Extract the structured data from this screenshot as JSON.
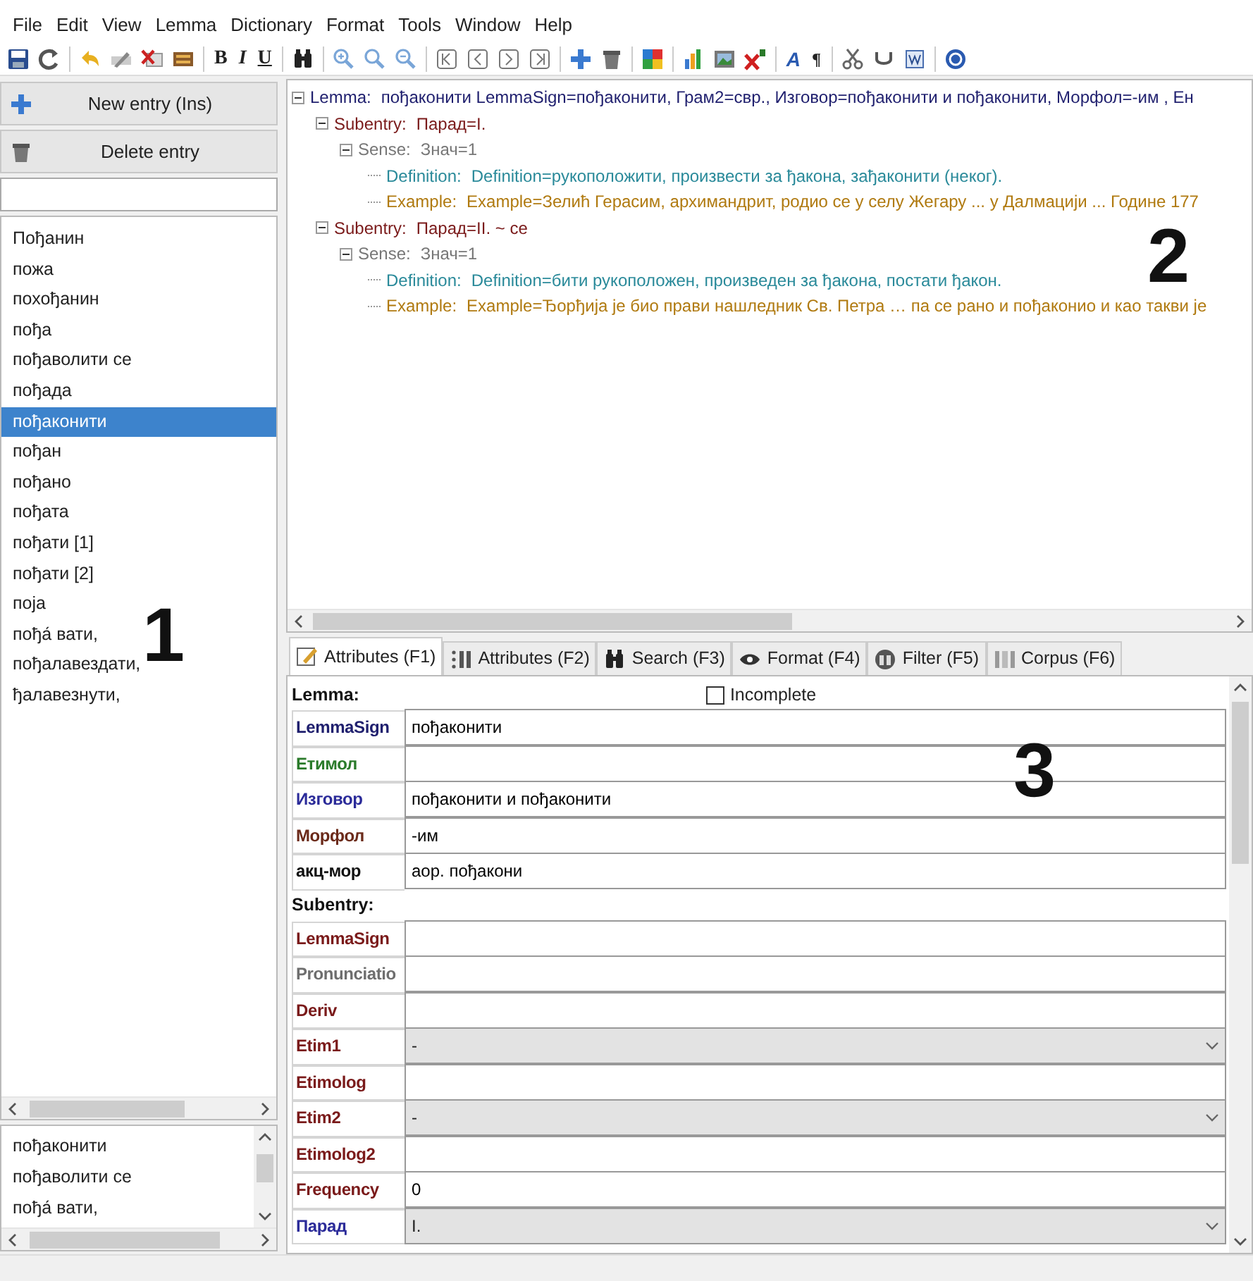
{
  "menu": [
    "File",
    "Edit",
    "View",
    "Lemma",
    "Dictionary",
    "Format",
    "Tools",
    "Window",
    "Help"
  ],
  "toolbar": {
    "format_buttons": [
      "B",
      "I",
      "U"
    ],
    "text_buttons": [
      "A",
      "¶"
    ]
  },
  "left_panel": {
    "buttons": [
      {
        "kind": "new",
        "label": "New entry (Ins)"
      },
      {
        "kind": "delete",
        "label": "Delete entry"
      }
    ],
    "entries": [
      {
        "text": "Пођанин",
        "selected": false
      },
      {
        "text": "пожа",
        "selected": false
      },
      {
        "text": "похођанин",
        "selected": false
      },
      {
        "text": "пођа",
        "selected": false
      },
      {
        "text": "пођаволити се",
        "selected": false
      },
      {
        "text": "пођада",
        "selected": false
      },
      {
        "text": "пођаконити",
        "selected": true
      },
      {
        "text": "пођан",
        "selected": false
      },
      {
        "text": "пођано",
        "selected": false
      },
      {
        "text": "пођата",
        "selected": false
      },
      {
        "text": "пођати [1]",
        "selected": false
      },
      {
        "text": "пођати [2]",
        "selected": false
      },
      {
        "text": "поја",
        "selected": false
      },
      {
        "text": "пођа́ вати,",
        "selected": false
      },
      {
        "text": "пођалавездати,",
        "selected": false
      },
      {
        "text": "ђалавезнути,",
        "selected": false
      }
    ],
    "callout": "1",
    "recent": [
      "пођаконити",
      "пођаволити се",
      "пођа́ вати,"
    ]
  },
  "tree": {
    "callout": "2",
    "nodes": [
      {
        "kind": "lemma",
        "label": "Lemma:",
        "text": "пођаконити  LemmaSign=пођаконити, Грам2=свр., Изговор=пођаконити и пођаконити, Морфол=-им , Ен",
        "expanded": true,
        "children": [
          {
            "kind": "subentry",
            "label": "Subentry:",
            "text": "Парад=I.",
            "expanded": true,
            "children": [
              {
                "kind": "sense",
                "label": "Sense:",
                "text": "Знач=1",
                "expanded": true,
                "children": [
                  {
                    "kind": "definition",
                    "label": "Definition:",
                    "text": "Definition=рукоположити, произвести за ђакона, зађаконити (неког)."
                  },
                  {
                    "kind": "example",
                    "label": "Example:",
                    "text": "Example=Зелић Герасим, архимандрит, родио се у селу Жегару ... у Далмацији ... Године 177"
                  }
                ]
              }
            ]
          },
          {
            "kind": "subentry",
            "label": "Subentry:",
            "text": "Парад=II. ~ се",
            "expanded": true,
            "children": [
              {
                "kind": "sense",
                "label": "Sense:",
                "text": "Знач=1",
                "expanded": true,
                "children": [
                  {
                    "kind": "definition",
                    "label": "Definition:",
                    "text": "Definition=бити рукоположен, произведен за ђакона, постати ђакон."
                  },
                  {
                    "kind": "example",
                    "label": "Example:",
                    "text": "Example=Ђорђија је био прави нашледник Св. Петра … па се рано и пођаконио и као такви је"
                  }
                ]
              }
            ]
          }
        ]
      }
    ]
  },
  "tabs": [
    {
      "label": "Attributes (F1)",
      "selected": true
    },
    {
      "label": "Attributes (F2)",
      "selected": false
    },
    {
      "label": "Search (F3)",
      "selected": false
    },
    {
      "label": "Format (F4)",
      "selected": false
    },
    {
      "label": "Filter (F5)",
      "selected": false
    },
    {
      "label": "Corpus (F6)",
      "selected": false
    }
  ],
  "attributes": {
    "callout": "3",
    "lemma_heading": "Lemma:",
    "incomplete": {
      "label": "Incomplete",
      "checked": false
    },
    "lemma_fields": [
      {
        "label": "LemmaSign",
        "color": "#1f1f6e",
        "kind": "text",
        "value": "пођаконити"
      },
      {
        "label": "Етимол",
        "color": "#2a7a2a",
        "kind": "text"
      },
      {
        "label": "Изговор",
        "color": "#2b2b99",
        "kind": "text",
        "value": "пођаконити и пођаконити"
      },
      {
        "label": "Морфол",
        "color": "#6b2a1a",
        "kind": "text",
        "value": "-им"
      },
      {
        "label": "акц-мор",
        "color": "#111111",
        "kind": "text",
        "value": "аор. пођакони"
      }
    ],
    "subentry_heading": "Subentry:",
    "subentry_fields": [
      {
        "label": "LemmaSign",
        "color": "#7a1a1a",
        "kind": "text"
      },
      {
        "label": "Pronunciatio",
        "color": "#6e6e6e",
        "kind": "text"
      },
      {
        "label": "Deriv",
        "color": "#7a1a1a",
        "kind": "text"
      },
      {
        "label": "Etim1",
        "color": "#7a1a1a",
        "kind": "select",
        "value": "-"
      },
      {
        "label": "Etimolog",
        "color": "#7a1a1a",
        "kind": "text"
      },
      {
        "label": "Etim2",
        "color": "#7a1a1a",
        "kind": "select",
        "value": "-"
      },
      {
        "label": "Etimolog2",
        "color": "#7a1a1a",
        "kind": "text"
      },
      {
        "label": "Frequency",
        "color": "#7a1a1a",
        "kind": "text",
        "value": "0"
      },
      {
        "label": "Парад",
        "color": "#2b2b99",
        "kind": "select",
        "value": "I."
      }
    ]
  }
}
